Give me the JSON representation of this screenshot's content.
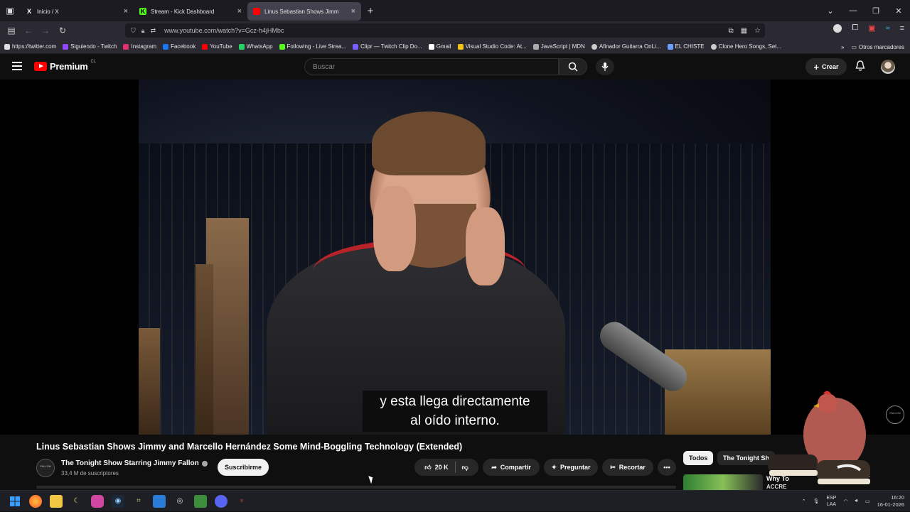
{
  "browser": {
    "tabs": [
      {
        "title": "Inicio / X",
        "icon": "x-logo-icon",
        "color": "#ffffff",
        "active": false
      },
      {
        "title": "Stream - Kick Dashboard",
        "icon": "kick-logo-icon",
        "color": "#53fc18",
        "active": false
      },
      {
        "title": "Linus Sebastian Shows Jimm",
        "icon": "youtube-logo-icon",
        "color": "#ff0000",
        "active": true
      }
    ],
    "url": "www.youtube.com/watch?v=Gcz-h4jHMbc",
    "bookmarks": [
      {
        "label": "https://twitter.com",
        "color": "#dddddd"
      },
      {
        "label": "Siguiendo - Twitch",
        "color": "#9146ff"
      },
      {
        "label": "Instagram",
        "color": "#e1306c"
      },
      {
        "label": "Facebook",
        "color": "#1877f2"
      },
      {
        "label": "YouTube",
        "color": "#ff0000"
      },
      {
        "label": "WhatsApp",
        "color": "#25d366"
      },
      {
        "label": "Following - Live Strea...",
        "color": "#53fc18"
      },
      {
        "label": "Clipr — Twitch Clip Do...",
        "color": "#7a5cff"
      },
      {
        "label": "Gmail",
        "color": "#ffffff"
      },
      {
        "label": "Visual Studio Code: At...",
        "color": "#f0c419"
      },
      {
        "label": "JavaScript | MDN",
        "color": "#aaaaaa"
      },
      {
        "label": "Afinador Guitarra OnLi...",
        "color": "#cccccc"
      },
      {
        "label": "EL CHISTE",
        "color": "#6aa0ff"
      },
      {
        "label": "Clone Hero Songs, Set...",
        "color": "#cccccc"
      }
    ],
    "other_bookmarks": "Otros marcadores"
  },
  "youtube": {
    "brand": "Premium",
    "region": "CL",
    "search_placeholder": "Buscar",
    "create_label": "Crear",
    "subtitle_line1": "y esta llega directamente",
    "subtitle_line2": "al oído interno.",
    "video_title": "Linus Sebastian Shows Jimmy and Marcello Hernández Some Mind-Boggling Technology (Extended)",
    "channel_name": "The Tonight Show Starring Jimmy Fallon",
    "subscribers": "33,4 M de suscriptores",
    "subscribe_label": "Suscribirme",
    "likes": "20 K",
    "share_label": "Compartir",
    "ask_label": "Preguntar",
    "clip_label": "Recortar",
    "chips": [
      "Todos",
      "The Tonight Sh"
    ],
    "recommendation_title": "Why To",
    "recommendation_line2": "ACCRE"
  },
  "taskbar": {
    "lang_top": "ESP",
    "lang_bottom": "LAA",
    "time": "16:20",
    "date": "16-01-2026"
  }
}
